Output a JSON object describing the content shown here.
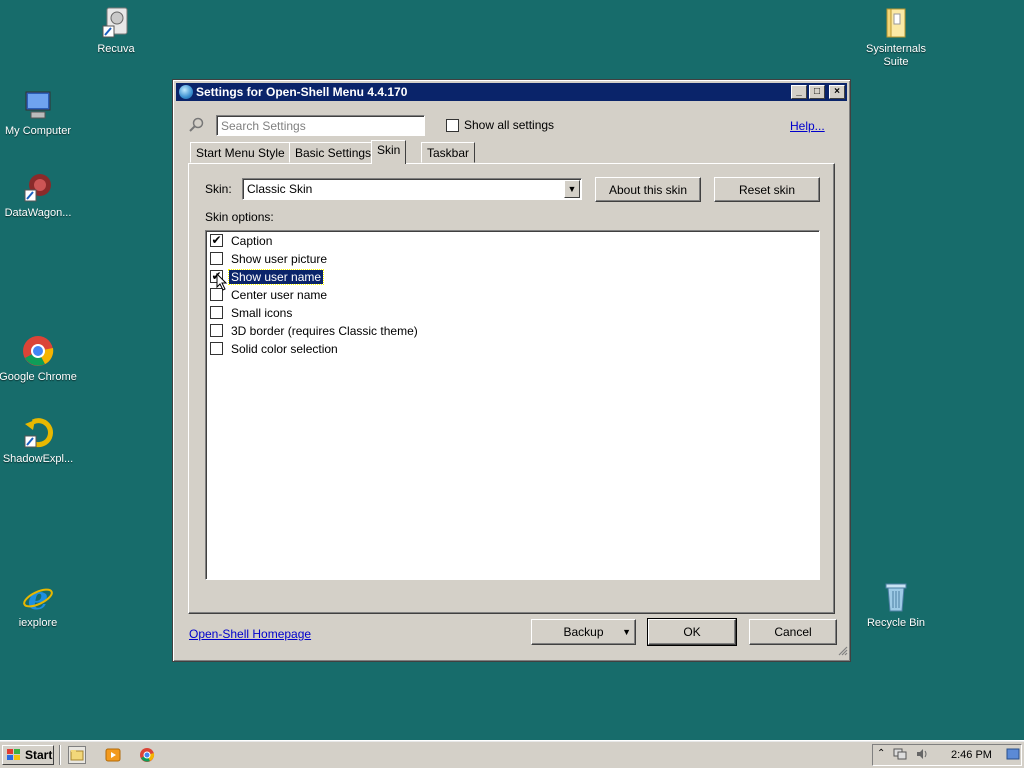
{
  "desktop": {
    "icons": {
      "recuva": "Recuva",
      "my_computer": "My Computer",
      "datawagon": "DataWagon...",
      "chrome": "Google Chrome",
      "shadowexplorer": "ShadowExpl...",
      "iexplore": "iexplore",
      "sysinternals_line1": "Sysinternals",
      "sysinternals_line2": "Suite",
      "recycle_bin": "Recycle Bin"
    }
  },
  "window": {
    "title": "Settings for Open-Shell Menu 4.4.170",
    "controls": {
      "minimize": "_",
      "maximize": "□",
      "close": "×"
    },
    "search": {
      "placeholder": "Search Settings"
    },
    "show_all_settings": {
      "label": "Show all settings",
      "checked": false
    },
    "help_link": "Help...",
    "tabs": [
      {
        "label": "Start Menu Style",
        "active": false
      },
      {
        "label": "Basic Settings",
        "active": false
      },
      {
        "label": "Skin",
        "active": true
      },
      {
        "label": "Taskbar",
        "active": false
      }
    ],
    "skin": {
      "label": "Skin:",
      "selected": "Classic Skin",
      "about_button": "About this skin",
      "reset_button": "Reset skin",
      "options_label": "Skin options:",
      "options": [
        {
          "label": "Caption",
          "checked": true,
          "selected": false
        },
        {
          "label": "Show user picture",
          "checked": false,
          "selected": false
        },
        {
          "label": "Show user name",
          "checked": true,
          "selected": true
        },
        {
          "label": "Center user name",
          "checked": false,
          "selected": false
        },
        {
          "label": "Small icons",
          "checked": false,
          "selected": false
        },
        {
          "label": "3D border (requires Classic theme)",
          "checked": false,
          "selected": false
        },
        {
          "label": "Solid color selection",
          "checked": false,
          "selected": false
        }
      ]
    },
    "footer": {
      "homepage_link": "Open-Shell Homepage",
      "backup_button": "Backup",
      "ok_button": "OK",
      "cancel_button": "Cancel"
    }
  },
  "taskbar": {
    "start_label": "Start",
    "clock": "2:46 PM"
  },
  "check_glyph": "✔"
}
